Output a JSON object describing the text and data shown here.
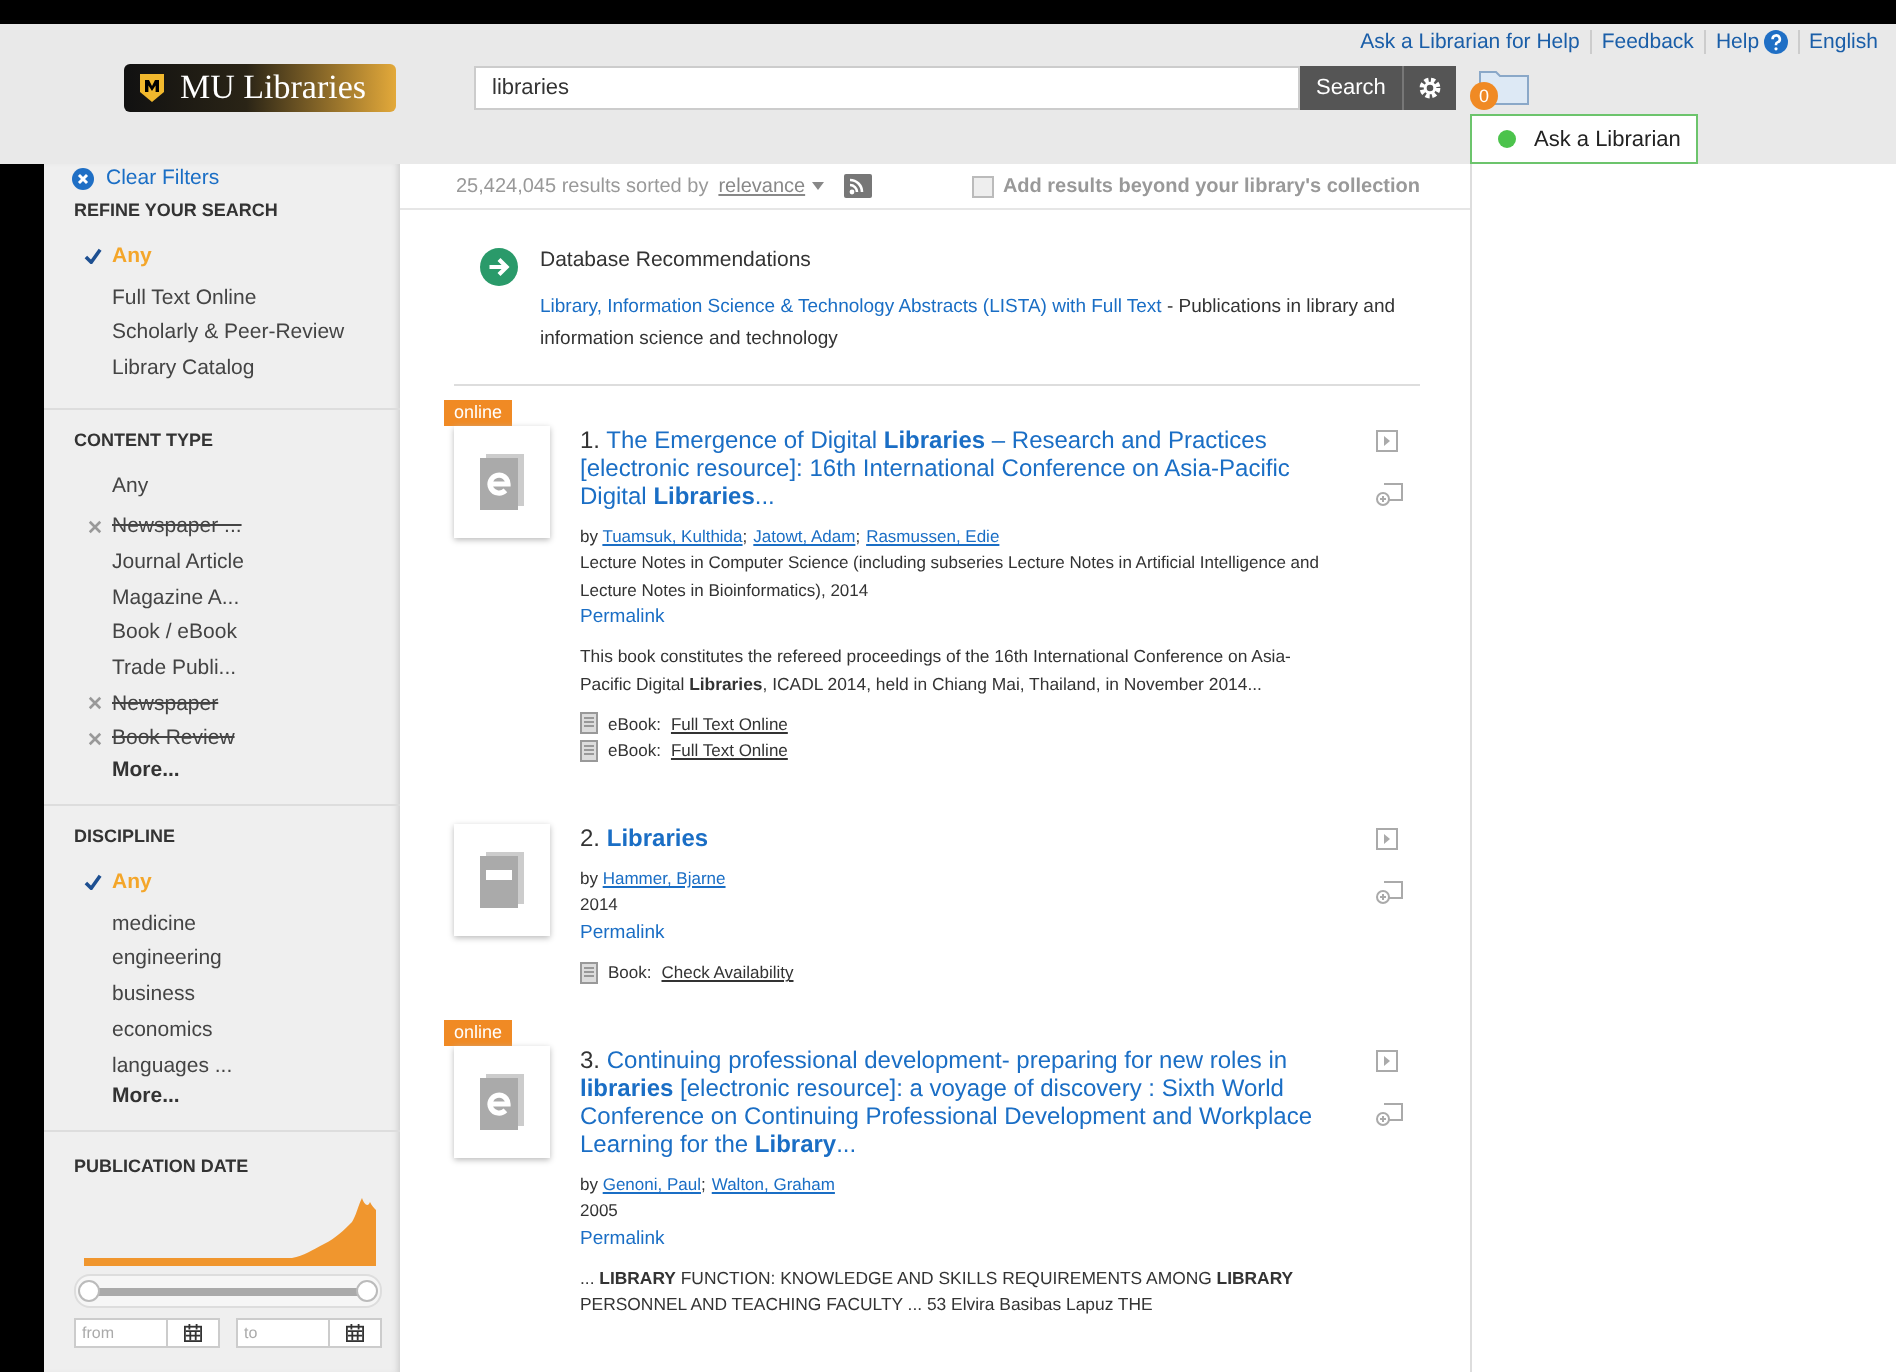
{
  "header": {
    "top_links": [
      "Ask a Librarian for Help",
      "Feedback",
      "Help",
      "English"
    ],
    "logo": "MU Libraries",
    "search": {
      "value": "libraries",
      "button": "Search"
    },
    "folder_count": "0",
    "chat": {
      "label": "Ask a Librarian",
      "color": "#4cc34c"
    }
  },
  "sidebar": {
    "clear_filters": "Clear Filters",
    "sections": [
      {
        "title": "REFINE YOUR SEARCH",
        "items": [
          {
            "label": "Any",
            "selected": true,
            "excluded": false
          },
          {
            "label": "Full Text Online",
            "selected": false,
            "excluded": false
          },
          {
            "label": "Scholarly & Peer-Review",
            "selected": false,
            "excluded": false
          },
          {
            "label": "Library Catalog",
            "selected": false,
            "excluded": false
          }
        ]
      },
      {
        "title": "CONTENT TYPE",
        "items": [
          {
            "label": "Any",
            "selected": false,
            "excluded": false
          },
          {
            "label": "Newspaper ...",
            "selected": false,
            "excluded": true
          },
          {
            "label": "Journal Article",
            "selected": false,
            "excluded": false
          },
          {
            "label": "Magazine A...",
            "selected": false,
            "excluded": false
          },
          {
            "label": "Book / eBook",
            "selected": false,
            "excluded": false
          },
          {
            "label": "Trade Publi...",
            "selected": false,
            "excluded": false
          },
          {
            "label": "Newspaper",
            "selected": false,
            "excluded": true
          },
          {
            "label": "Book Review",
            "selected": false,
            "excluded": true
          }
        ],
        "more": "More..."
      },
      {
        "title": "DISCIPLINE",
        "items": [
          {
            "label": "Any",
            "selected": true,
            "excluded": false
          },
          {
            "label": "medicine",
            "selected": false,
            "excluded": false
          },
          {
            "label": "engineering",
            "selected": false,
            "excluded": false
          },
          {
            "label": "business",
            "selected": false,
            "excluded": false
          },
          {
            "label": "economics",
            "selected": false,
            "excluded": false
          },
          {
            "label": "languages ...",
            "selected": false,
            "excluded": false
          }
        ],
        "more": "More..."
      }
    ],
    "publication_date": {
      "title": "PUBLICATION DATE",
      "thumbs": [
        {
          "level": 0
        },
        {
          "level": 1
        }
      ],
      "from_placeholder": "from",
      "to_placeholder": "to"
    }
  },
  "results_bar": {
    "count": "25,424,045 results sorted by",
    "sort": "relevance",
    "beyond": {
      "label": "Add results beyond your library's collection",
      "checked": false
    }
  },
  "recommendation": {
    "heading": "Database Recommendations",
    "link": "Library, Information Science & Technology Abstracts (LISTA) with Full Text",
    "description": " - Publications in library and information science and technology"
  },
  "author_separator": ";",
  "results": [
    {
      "number": "1.",
      "title": "The Emergence of Digital **Libraries** – Research and Practices [electronic resource]: 16th International Conference on Asia-Pacific Digital **Libraries**...",
      "badge": "online",
      "kind": "ebook",
      "by": "by",
      "authors": [
        "Tuamsuk, Kulthida",
        "Jatowt, Adam",
        "Rasmussen, Edie"
      ],
      "meta": [
        "Lecture Notes in Computer Science (including subseries Lecture Notes in Artificial Intelligence and Lecture Notes in Bioinformatics), 2014"
      ],
      "permalink": "Permalink",
      "snippet": "This book constitutes the refereed proceedings of the 16th International Conference on Asia-Pacific Digital **Libraries**, ICADL 2014, held in Chiang Mai, Thailand, in November 2014...",
      "access": [
        {
          "type": "eBook:",
          "link": "Full Text Online"
        },
        {
          "type": "eBook:",
          "link": "Full Text Online"
        }
      ]
    },
    {
      "number": "2.",
      "title": "**Libraries**",
      "kind": "book",
      "by": "by",
      "authors": [
        "Hammer, Bjarne"
      ],
      "meta": [
        "2014"
      ],
      "permalink": "Permalink",
      "access": [
        {
          "type": "Book:",
          "link": "Check Availability"
        }
      ]
    },
    {
      "number": "3.",
      "title": "Continuing professional development- preparing for new roles in **libraries** [electronic resource]: a voyage of discovery : Sixth World Conference on Continuing Professional Development and Workplace Learning for the **Library**...",
      "badge": "online",
      "kind": "ebook",
      "by": "by",
      "authors": [
        "Genoni, Paul",
        "Walton, Graham"
      ],
      "meta": [
        "2005"
      ],
      "permalink": "Permalink",
      "snippet": "... **LIBRARY** FUNCTION: KNOWLEDGE AND SKILLS REQUIREMENTS AMONG **LIBRARY** PERSONNEL AND TEACHING FACULTY ... 53 Elvira Basibas Lapuz THE"
    }
  ]
}
